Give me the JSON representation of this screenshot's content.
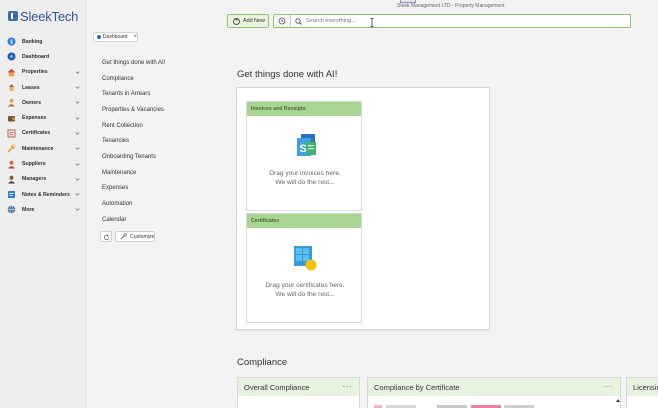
{
  "app": {
    "brand": "SleekTech",
    "window_title": "Sleek Management LTD - Property Management"
  },
  "sidebar": {
    "items": [
      {
        "label": "Banking",
        "icon": "bank-icon",
        "expandable": false
      },
      {
        "label": "Dashboard",
        "icon": "dashboard-icon",
        "expandable": false
      },
      {
        "label": "Properties",
        "icon": "house-icon",
        "expandable": true
      },
      {
        "label": "Leases",
        "icon": "lease-icon",
        "expandable": true
      },
      {
        "label": "Owners",
        "icon": "person-icon",
        "expandable": true
      },
      {
        "label": "Expenses",
        "icon": "expenses-icon",
        "expandable": true
      },
      {
        "label": "Certificates",
        "icon": "certificate-icon",
        "expandable": true
      },
      {
        "label": "Maintenance",
        "icon": "wrench-icon",
        "expandable": true
      },
      {
        "label": "Suppliers",
        "icon": "supplier-icon",
        "expandable": true
      },
      {
        "label": "Managers",
        "icon": "manager-icon",
        "expandable": true
      },
      {
        "label": "Notes & Reminders",
        "icon": "notes-icon",
        "expandable": true
      },
      {
        "label": "More",
        "icon": "globe-icon",
        "expandable": true
      }
    ]
  },
  "toolbar": {
    "add_new_label": "Add New",
    "search_placeholder": "Search everything..."
  },
  "tabs": [
    {
      "label": "Dashboard",
      "close": "×"
    }
  ],
  "dashboard_menu": {
    "items": [
      "Get things done with AI!",
      "Compliance",
      "Tenants in Arrears",
      "Properties & Vacancies",
      "Rent Collection",
      "Tenancies",
      "Onboarding Tenants",
      "Maintenance",
      "Expenses",
      "Automation",
      "Calendar"
    ],
    "customize_label": "Customize"
  },
  "ai_section": {
    "heading": "Get things done with AI!",
    "cards": [
      {
        "title": "Invoices and Receipts",
        "line1": "Drag your invoices here.",
        "line2": "We will do the rest..."
      },
      {
        "title": "Certificates",
        "line1": "Drag your certificates here.",
        "line2": "We will do the rest..."
      }
    ]
  },
  "compliance_section": {
    "heading": "Compliance",
    "widgets": [
      {
        "title": "Overall Compliance",
        "more": "···"
      },
      {
        "title": "Compliance by Certificate",
        "more": "···"
      },
      {
        "title": "Licensin",
        "more": ""
      }
    ]
  },
  "colors": {
    "accent_green": "#8fc46d",
    "card_header_green": "#a8d58f",
    "brand_blue": "#2e5596"
  }
}
